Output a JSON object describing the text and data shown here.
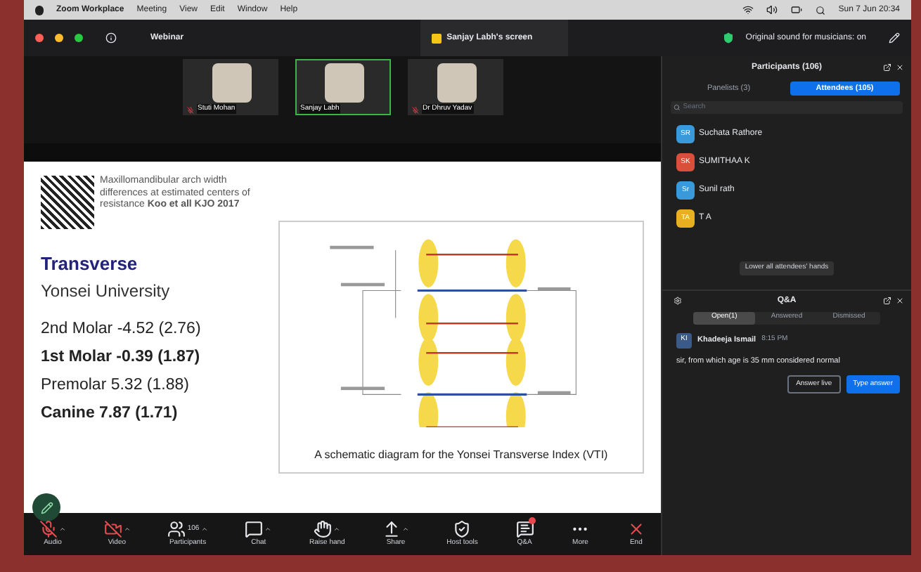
{
  "menu_bar": {
    "items": [
      "Zoom Workplace",
      "Meeting",
      "View",
      "Edit",
      "Window",
      "Help"
    ],
    "clock": "Sun 7 Jun 20:34"
  },
  "title_bar": {
    "title": "Webinar",
    "screen_tab": "Sanjay Labh's screen",
    "audio_status": "Original sound for musicians: on"
  },
  "video_tiles": [
    {
      "name": "Stuti Mohan",
      "muted": true,
      "speaking": false
    },
    {
      "name": "Sanjay Labh",
      "muted": false,
      "speaking": true
    },
    {
      "name": "Dr Dhruv Yadav",
      "muted": true,
      "speaking": false
    }
  ],
  "slide": {
    "note": "Maxillomandibular arch width differences at estimated centers of resistance **Koo et all KJO 2017**",
    "heading": "Transverse",
    "subheading": "Yonsei University",
    "measurements": [
      {
        "text": "2nd Molar -4.52 (2.76)",
        "bold": false
      },
      {
        "text": "1st Molar -0.39 (1.87)",
        "bold": true
      },
      {
        "text": "Premolar 5.32 (1.88)",
        "bold": false
      },
      {
        "text": "Canine 7.87 (1.71)",
        "bold": true
      }
    ],
    "figure_caption": "A schematic diagram for the Yonsei Transverse Index (VTI)"
  },
  "toolbar": [
    {
      "label": "Audio",
      "kind": "audio",
      "off": true
    },
    {
      "label": "Video",
      "kind": "video",
      "off": true
    },
    {
      "label": "Participants",
      "kind": "participants",
      "count": "106"
    },
    {
      "label": "Chat",
      "kind": "chat"
    },
    {
      "label": "Raise hand",
      "kind": "hand"
    },
    {
      "label": "Share",
      "kind": "share"
    },
    {
      "label": "Host tools",
      "kind": "shield"
    },
    {
      "label": "Q&A",
      "kind": "qa",
      "badge": true
    },
    {
      "label": "More",
      "kind": "more"
    },
    {
      "label": "End",
      "kind": "end"
    }
  ],
  "participants": {
    "title": "Participants (106)",
    "tabs": [
      {
        "label": "Panelists (3)",
        "selected": false
      },
      {
        "label": "Attendees (105)",
        "selected": true
      }
    ],
    "search": {
      "placeholder": "Search"
    },
    "attendees": [
      {
        "initials": "SR",
        "name": "Suchata Rathore",
        "color": "#3a9ad9"
      },
      {
        "initials": "SK",
        "name": "SUMITHAA K",
        "color": "#d9503a"
      },
      {
        "initials": "Sr",
        "name": "Sunil rath",
        "color": "#3a9ad9"
      },
      {
        "initials": "TA",
        "name": "T A",
        "color": "#e8b020"
      }
    ],
    "lower_hands_button": "Lower all attendees' hands"
  },
  "qa": {
    "title": "Q&A",
    "tabs": [
      {
        "label": "Open(1)",
        "selected": true
      },
      {
        "label": "Answered",
        "selected": false
      },
      {
        "label": "Dismissed",
        "selected": false
      }
    ],
    "questions": [
      {
        "initials": "KI",
        "author": "Khadeeja Ismail",
        "time": "8:15 PM",
        "text": "sir, from which age is 35 mm considered normal"
      }
    ],
    "buttons": [
      {
        "label": "Answer live",
        "primary": false
      },
      {
        "label": "Type answer",
        "primary": true
      }
    ]
  }
}
